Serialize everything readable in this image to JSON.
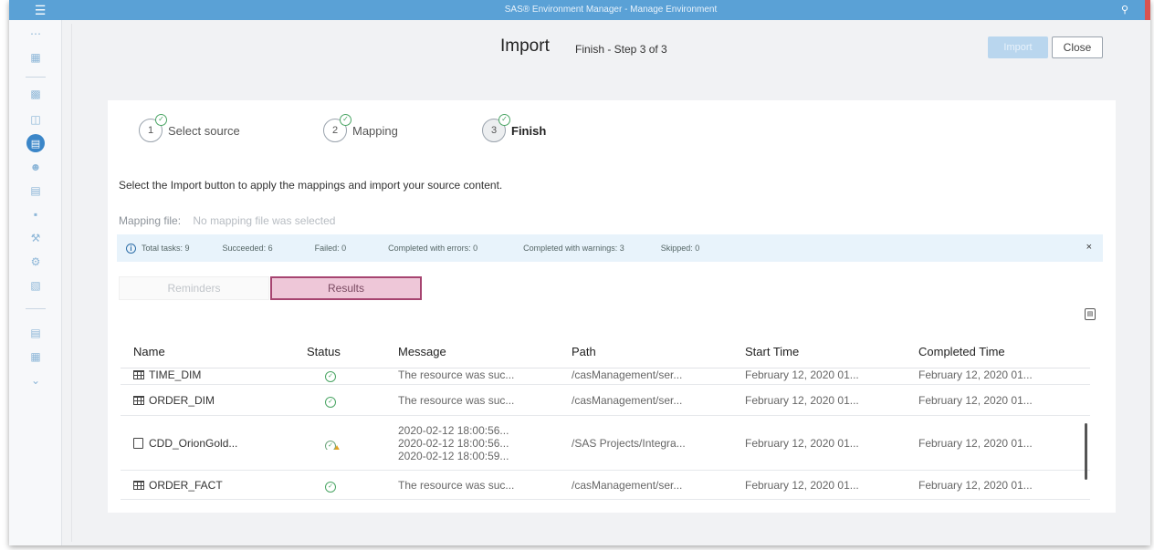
{
  "app": {
    "title": "SAS® Environment Manager - Manage Environment",
    "menu_icon": "hamburger-icon",
    "search_icon": "search-icon"
  },
  "sidebar": {
    "icons": [
      "grid-icon",
      "table-icon",
      "server-icon",
      "content-icon",
      "users-icon",
      "report-icon",
      "security-icon",
      "tools-icon",
      "jobs-icon",
      "rules-icon",
      "document-icon",
      "environment-icon",
      "expand-icon"
    ],
    "active_index": 3
  },
  "dialog": {
    "title": "Import",
    "step_text": "Finish - Step 3 of 3",
    "import_label": "Import",
    "close_label": "Close"
  },
  "steps": [
    {
      "number": "1",
      "label": "Select source",
      "complete": true
    },
    {
      "number": "2",
      "label": "Mapping",
      "complete": true
    },
    {
      "number": "3",
      "label": "Finish",
      "complete": true,
      "current": true
    }
  ],
  "instruction": "Select the Import button to apply the mappings and import your source content.",
  "mapping": {
    "label": "Mapping file:",
    "value": "No mapping file was selected"
  },
  "summary": {
    "total": "Total tasks: 9",
    "succeeded": "Succeeded: 6",
    "failed": "Failed: 0",
    "errors": "Completed with errors: 0",
    "warnings": "Completed with warnings: 3",
    "skipped": "Skipped: 0",
    "close": "×"
  },
  "tabs": {
    "reminders": "Reminders",
    "results": "Results",
    "active": "results"
  },
  "table": {
    "headers": {
      "name": "Name",
      "status": "Status",
      "message": "Message",
      "path": "Path",
      "start": "Start Time",
      "completed": "Completed Time"
    },
    "rows": [
      {
        "type": "table",
        "name": "TIME_DIM",
        "status": "success",
        "message": "The resource was suc...",
        "path": "/casManagement/ser...",
        "start": "February 12, 2020 01...",
        "completed": "February 12, 2020 01..."
      },
      {
        "type": "table",
        "name": "ORDER_DIM",
        "status": "success",
        "message": "The resource was suc...",
        "path": "/casManagement/ser...",
        "start": "February 12, 2020 01...",
        "completed": "February 12, 2020 01..."
      },
      {
        "type": "file",
        "name": "CDD_OrionGold...",
        "status": "warning",
        "message_lines": [
          "2020-02-12 18:00:56...",
          "2020-02-12 18:00:56...",
          "2020-02-12 18:00:59..."
        ],
        "path": "/SAS Projects/Integra...",
        "start": "February 12, 2020 01...",
        "completed": "February 12, 2020 01..."
      },
      {
        "type": "table",
        "name": "ORDER_FACT",
        "status": "success",
        "message": "The resource was suc...",
        "path": "/casManagement/ser...",
        "start": "February 12, 2020 01...",
        "completed": "February 12, 2020 01..."
      }
    ]
  }
}
